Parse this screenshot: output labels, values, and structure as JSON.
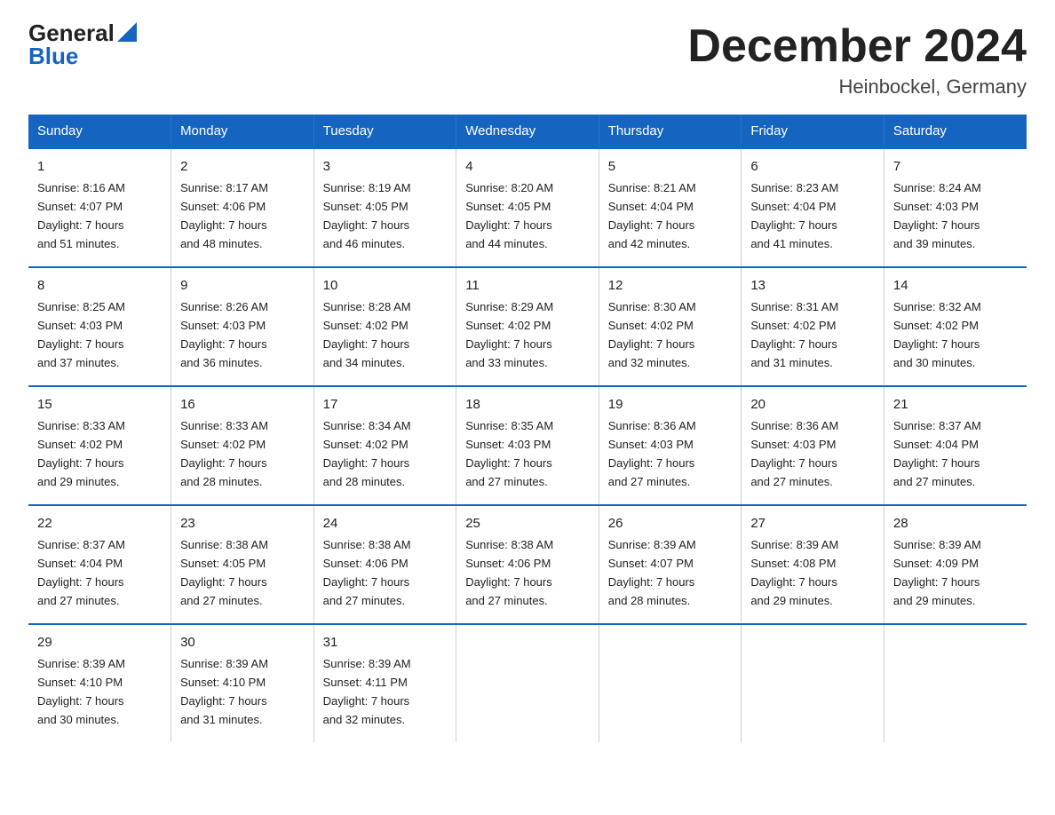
{
  "header": {
    "logo_general": "General",
    "logo_blue": "Blue",
    "title": "December 2024",
    "location": "Heinbockel, Germany"
  },
  "columns": [
    "Sunday",
    "Monday",
    "Tuesday",
    "Wednesday",
    "Thursday",
    "Friday",
    "Saturday"
  ],
  "weeks": [
    [
      {
        "day": "1",
        "sunrise": "8:16 AM",
        "sunset": "4:07 PM",
        "daylight": "7 hours and 51 minutes."
      },
      {
        "day": "2",
        "sunrise": "8:17 AM",
        "sunset": "4:06 PM",
        "daylight": "7 hours and 48 minutes."
      },
      {
        "day": "3",
        "sunrise": "8:19 AM",
        "sunset": "4:05 PM",
        "daylight": "7 hours and 46 minutes."
      },
      {
        "day": "4",
        "sunrise": "8:20 AM",
        "sunset": "4:05 PM",
        "daylight": "7 hours and 44 minutes."
      },
      {
        "day": "5",
        "sunrise": "8:21 AM",
        "sunset": "4:04 PM",
        "daylight": "7 hours and 42 minutes."
      },
      {
        "day": "6",
        "sunrise": "8:23 AM",
        "sunset": "4:04 PM",
        "daylight": "7 hours and 41 minutes."
      },
      {
        "day": "7",
        "sunrise": "8:24 AM",
        "sunset": "4:03 PM",
        "daylight": "7 hours and 39 minutes."
      }
    ],
    [
      {
        "day": "8",
        "sunrise": "8:25 AM",
        "sunset": "4:03 PM",
        "daylight": "7 hours and 37 minutes."
      },
      {
        "day": "9",
        "sunrise": "8:26 AM",
        "sunset": "4:03 PM",
        "daylight": "7 hours and 36 minutes."
      },
      {
        "day": "10",
        "sunrise": "8:28 AM",
        "sunset": "4:02 PM",
        "daylight": "7 hours and 34 minutes."
      },
      {
        "day": "11",
        "sunrise": "8:29 AM",
        "sunset": "4:02 PM",
        "daylight": "7 hours and 33 minutes."
      },
      {
        "day": "12",
        "sunrise": "8:30 AM",
        "sunset": "4:02 PM",
        "daylight": "7 hours and 32 minutes."
      },
      {
        "day": "13",
        "sunrise": "8:31 AM",
        "sunset": "4:02 PM",
        "daylight": "7 hours and 31 minutes."
      },
      {
        "day": "14",
        "sunrise": "8:32 AM",
        "sunset": "4:02 PM",
        "daylight": "7 hours and 30 minutes."
      }
    ],
    [
      {
        "day": "15",
        "sunrise": "8:33 AM",
        "sunset": "4:02 PM",
        "daylight": "7 hours and 29 minutes."
      },
      {
        "day": "16",
        "sunrise": "8:33 AM",
        "sunset": "4:02 PM",
        "daylight": "7 hours and 28 minutes."
      },
      {
        "day": "17",
        "sunrise": "8:34 AM",
        "sunset": "4:02 PM",
        "daylight": "7 hours and 28 minutes."
      },
      {
        "day": "18",
        "sunrise": "8:35 AM",
        "sunset": "4:03 PM",
        "daylight": "7 hours and 27 minutes."
      },
      {
        "day": "19",
        "sunrise": "8:36 AM",
        "sunset": "4:03 PM",
        "daylight": "7 hours and 27 minutes."
      },
      {
        "day": "20",
        "sunrise": "8:36 AM",
        "sunset": "4:03 PM",
        "daylight": "7 hours and 27 minutes."
      },
      {
        "day": "21",
        "sunrise": "8:37 AM",
        "sunset": "4:04 PM",
        "daylight": "7 hours and 27 minutes."
      }
    ],
    [
      {
        "day": "22",
        "sunrise": "8:37 AM",
        "sunset": "4:04 PM",
        "daylight": "7 hours and 27 minutes."
      },
      {
        "day": "23",
        "sunrise": "8:38 AM",
        "sunset": "4:05 PM",
        "daylight": "7 hours and 27 minutes."
      },
      {
        "day": "24",
        "sunrise": "8:38 AM",
        "sunset": "4:06 PM",
        "daylight": "7 hours and 27 minutes."
      },
      {
        "day": "25",
        "sunrise": "8:38 AM",
        "sunset": "4:06 PM",
        "daylight": "7 hours and 27 minutes."
      },
      {
        "day": "26",
        "sunrise": "8:39 AM",
        "sunset": "4:07 PM",
        "daylight": "7 hours and 28 minutes."
      },
      {
        "day": "27",
        "sunrise": "8:39 AM",
        "sunset": "4:08 PM",
        "daylight": "7 hours and 29 minutes."
      },
      {
        "day": "28",
        "sunrise": "8:39 AM",
        "sunset": "4:09 PM",
        "daylight": "7 hours and 29 minutes."
      }
    ],
    [
      {
        "day": "29",
        "sunrise": "8:39 AM",
        "sunset": "4:10 PM",
        "daylight": "7 hours and 30 minutes."
      },
      {
        "day": "30",
        "sunrise": "8:39 AM",
        "sunset": "4:10 PM",
        "daylight": "7 hours and 31 minutes."
      },
      {
        "day": "31",
        "sunrise": "8:39 AM",
        "sunset": "4:11 PM",
        "daylight": "7 hours and 32 minutes."
      },
      null,
      null,
      null,
      null
    ]
  ],
  "labels": {
    "sunrise": "Sunrise:",
    "sunset": "Sunset:",
    "daylight": "Daylight:"
  }
}
